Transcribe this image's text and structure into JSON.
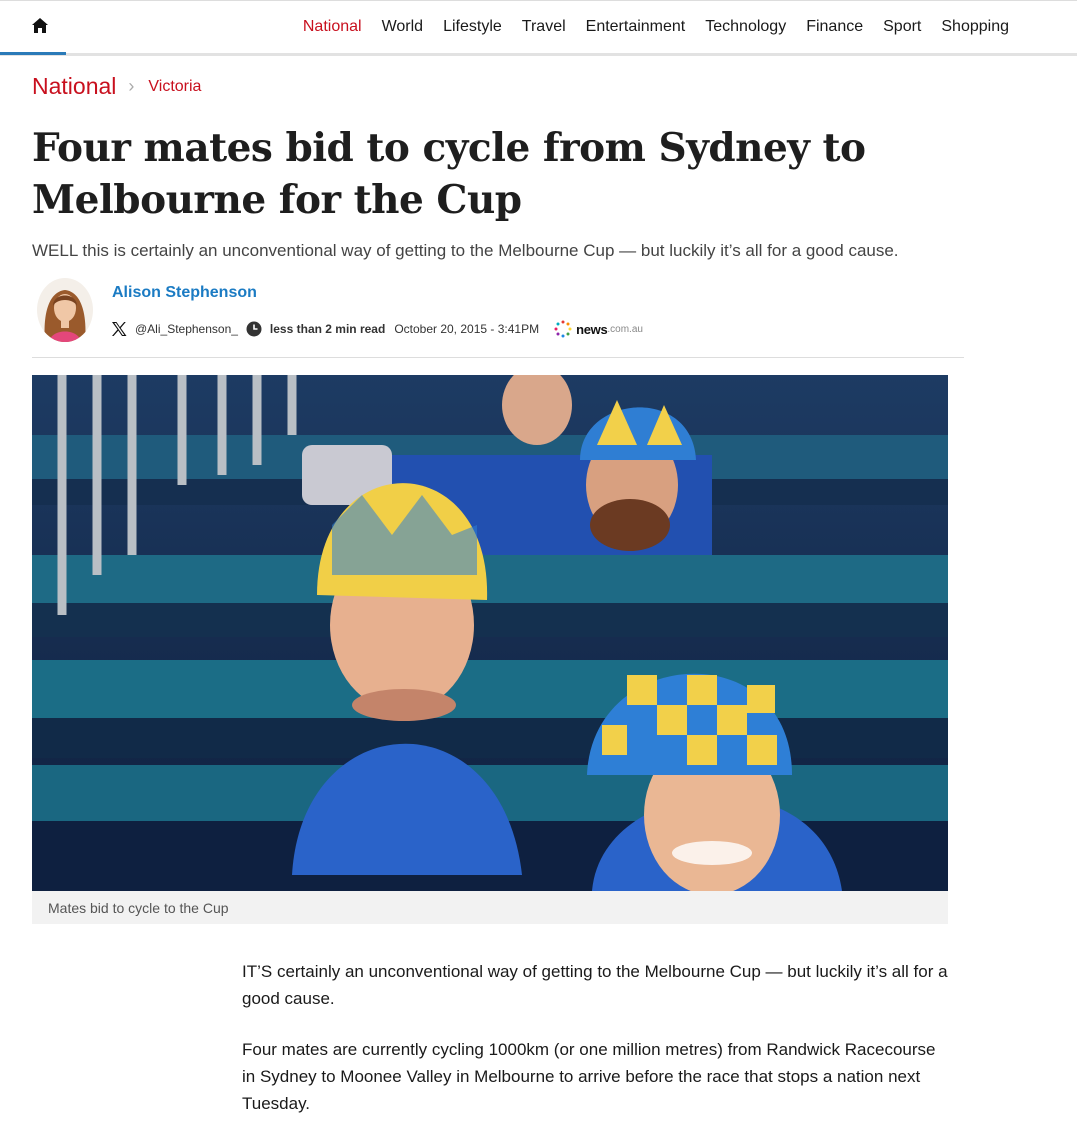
{
  "nav": {
    "items": [
      {
        "label": "National",
        "active": true
      },
      {
        "label": "World"
      },
      {
        "label": "Lifestyle"
      },
      {
        "label": "Travel"
      },
      {
        "label": "Entertainment"
      },
      {
        "label": "Technology"
      },
      {
        "label": "Finance"
      },
      {
        "label": "Sport"
      },
      {
        "label": "Shopping"
      }
    ],
    "home_icon": "home-icon"
  },
  "breadcrumb": {
    "section": "National",
    "subsection": "Victoria"
  },
  "article": {
    "headline": "Four mates bid to cycle from Sydney to Melbourne for the Cup",
    "standfirst": "WELL this is certainly an unconventional way of getting to the Melbourne Cup — but luckily it’s all for a good cause.",
    "author": {
      "name": "Alison Stephenson",
      "handle": "@Ali_Stephenson_"
    },
    "read_time": "less than 2 min read",
    "timestamp": "October 20, 2015 - 3:41PM",
    "publisher": {
      "name": "news",
      "domain": ".com.au"
    },
    "image_caption": "Mates bid to cycle to the Cup",
    "paragraphs": [
      "IT’S certainly an unconventional way of getting to the Melbourne Cup — but luckily it’s all for a good cause.",
      "Four mates are currently cycling 1000km (or one million metres) from Randwick Racecourse in Sydney to Moonee Valley in Melbourne to arrive before the race that stops a nation next Tuesday."
    ]
  },
  "colors": {
    "accent": "#c8101e",
    "author_link": "#1b7bc3"
  }
}
